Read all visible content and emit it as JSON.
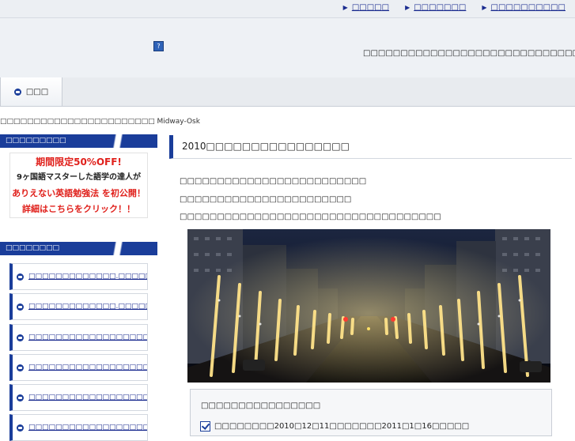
{
  "header": {
    "top_links": [
      "□□□□□",
      "□□□□□□□",
      "□□□□□□□□□□"
    ],
    "site_description": "□□□□□□□□□□□□□□□□□□□□□□□□□□□□□",
    "logo_placeholder": "?"
  },
  "nav": {
    "home_label": "□□□"
  },
  "breadcrumb": "□□□□□□□□□□□□□□□□□□□□□□□ Midway-Osk",
  "sidebar": {
    "section1_title": "□□□□□□□□□",
    "ad_banner": {
      "line1": "期間限定50%OFF!",
      "line2": "9ヶ国語マスターした語学の達人が",
      "line3": "ありえない英語勉強法 を初公開！",
      "line4": "詳細はこちらをクリック！！"
    },
    "section2_title": "□□□□□□□□",
    "links": [
      "□□□□□□□□□□□□□.□□□□□□□",
      "□□□□□□□□□□□□□.□□□□□□□",
      "□□□□□□□□□□□□□□□□□□□□",
      "□□□□□□□□□□□□□□□□□□□□",
      "□□□□□□□□□□□□□□□□□□□",
      "□□□□□□□□□□□□□□□□□□□□□"
    ]
  },
  "main": {
    "entry_title": "2010□□□□□□□□□□□□□□□□",
    "paragraphs": [
      "□□□□□□□□□□□□□□□□□□□□□□□□□",
      "□□□□□□□□□□□□□□□□□□□□□□□",
      "□□□□□□□□□□□□□□□□□□□□□□□□□□□□□□□□□□□"
    ],
    "info_box": {
      "title": "□□□□□□□□□□□□□□□□",
      "row": "□□□□□□□□2010□12□11□□□□□□□2011□1□16□□□□□"
    }
  }
}
